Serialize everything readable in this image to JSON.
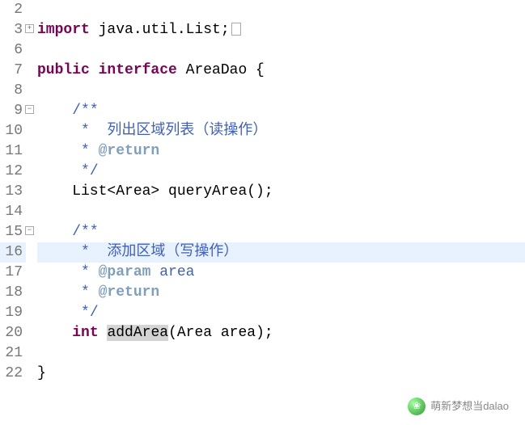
{
  "lines": [
    {
      "n": 2,
      "fold": "",
      "content": ""
    },
    {
      "n": 3,
      "fold": "plus",
      "content": "import java.util.List;",
      "collapsed": true
    },
    {
      "n": 6,
      "fold": "",
      "content": ""
    },
    {
      "n": 7,
      "fold": "",
      "content": "public interface AreaDao {"
    },
    {
      "n": 8,
      "fold": "",
      "content": ""
    },
    {
      "n": 9,
      "fold": "minus",
      "content": "    /**"
    },
    {
      "n": 10,
      "fold": "",
      "content": "     *  列出区域列表（读操作）"
    },
    {
      "n": 11,
      "fold": "",
      "content": "     * @return"
    },
    {
      "n": 12,
      "fold": "",
      "content": "     */"
    },
    {
      "n": 13,
      "fold": "",
      "content": "    List<Area> queryArea();"
    },
    {
      "n": 14,
      "fold": "",
      "content": ""
    },
    {
      "n": 15,
      "fold": "minus",
      "content": "    /**"
    },
    {
      "n": 16,
      "fold": "",
      "content": "     *  添加区域（写操作）",
      "highlight": true
    },
    {
      "n": 17,
      "fold": "",
      "content": "     * @param area"
    },
    {
      "n": 18,
      "fold": "",
      "content": "     * @return"
    },
    {
      "n": 19,
      "fold": "",
      "content": "     */"
    },
    {
      "n": 20,
      "fold": "",
      "content": "    int addArea(Area area);"
    },
    {
      "n": 21,
      "fold": "",
      "content": ""
    },
    {
      "n": 22,
      "fold": "",
      "content": "}"
    }
  ],
  "watermark": "萌新梦想当dalao"
}
